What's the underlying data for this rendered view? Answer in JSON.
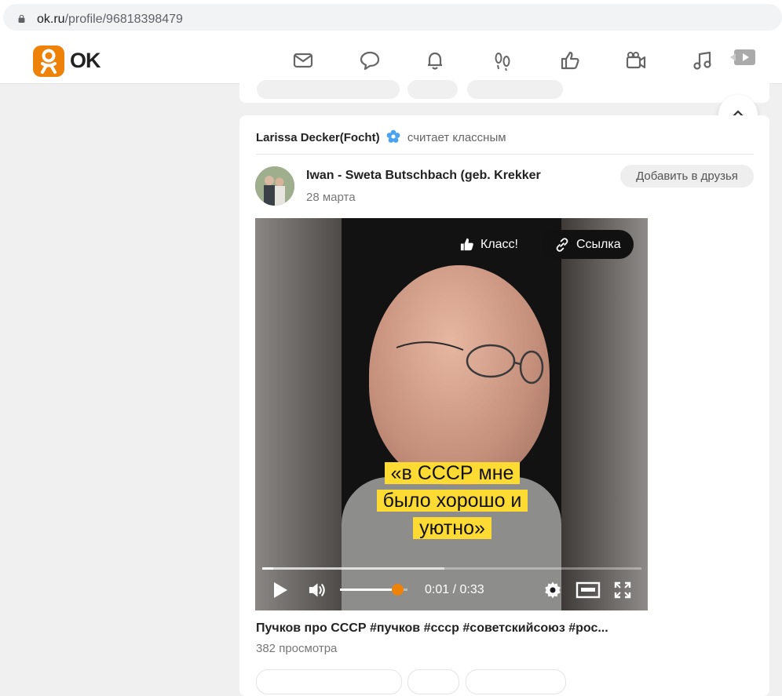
{
  "browser": {
    "url_domain": "ok.ru",
    "url_path": "/profile/96818398479"
  },
  "header": {
    "logo_text": "OK",
    "nav_icons": [
      "mail-icon",
      "chat-icon",
      "bell-icon",
      "guests-footprints-icon",
      "thumbs-up-icon",
      "video-camera-icon",
      "music-icon",
      "video-play-icon"
    ],
    "brand_color": "#ee8208"
  },
  "feed_item": {
    "liker_name": "Larissa Decker(Focht)",
    "liker_action": "считает классным",
    "author_name": "Iwan - Sweta Butschbach (geb. Krekker",
    "post_date": "28 марта",
    "add_friend_label": "Добавить в друзья",
    "video": {
      "class_label": "Класс!",
      "link_label": "Ссылка",
      "caption_lines": [
        "«в СССР мне",
        "было хорошо и",
        "уютно»"
      ],
      "time_display": "0:01 / 0:33",
      "progress_fraction": 0.03,
      "volume_fraction": 0.85
    },
    "video_title": "Пучков про СССР #пучков #ссср #советскийсоюз #рос...",
    "views": "382 просмотра"
  }
}
